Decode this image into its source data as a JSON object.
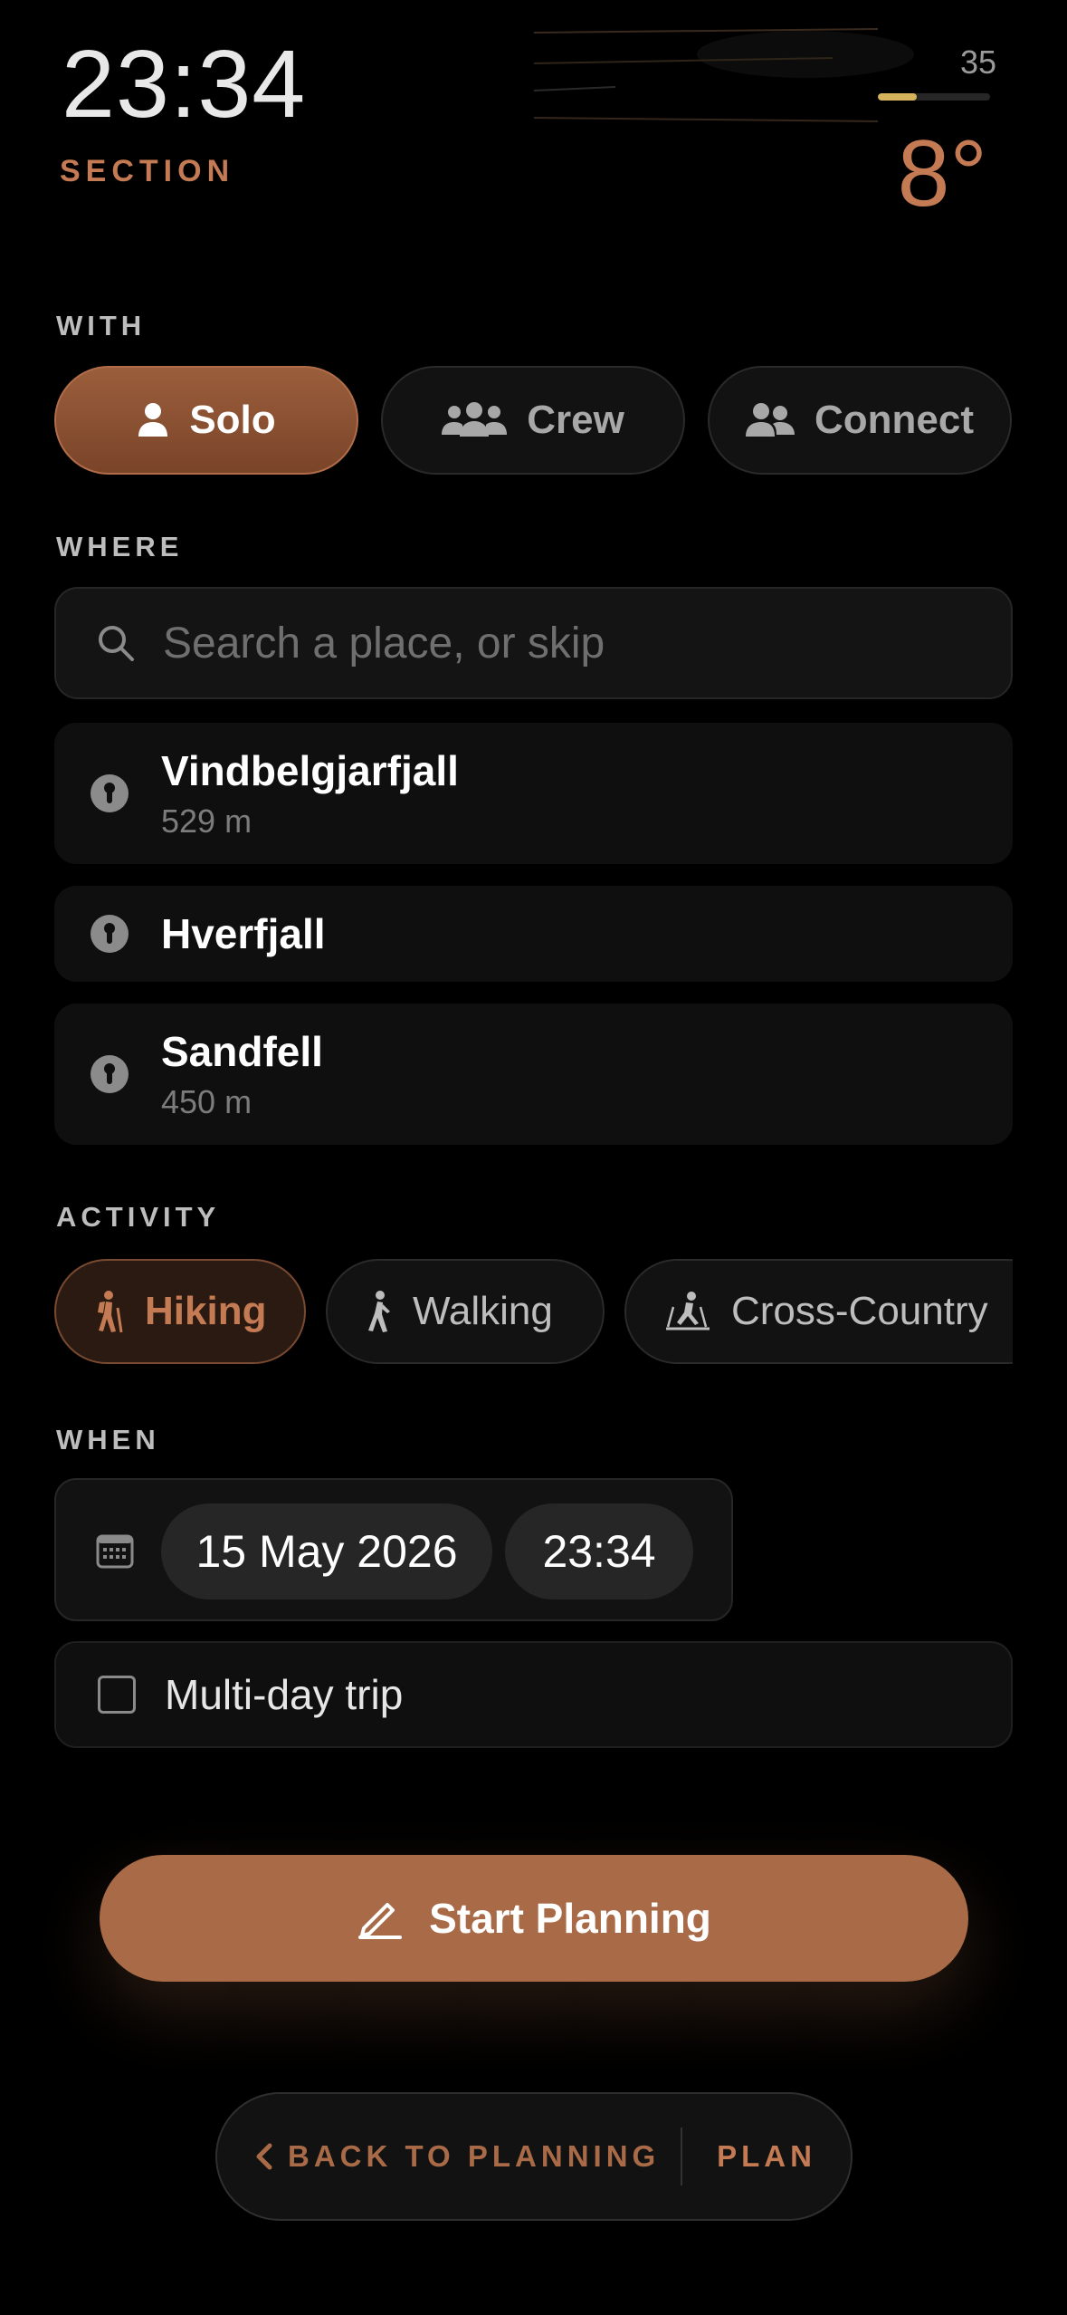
{
  "header": {
    "time": "23:34",
    "section_label": "SECTION",
    "uv_value": "35",
    "uv_fraction": 0.35,
    "temperature": "8°"
  },
  "with": {
    "title": "WITH",
    "options": [
      {
        "label": "Solo",
        "icon": "person-icon",
        "active": true
      },
      {
        "label": "Crew",
        "icon": "group-icon",
        "active": false
      },
      {
        "label": "Connect",
        "icon": "people-icon",
        "active": false
      }
    ]
  },
  "where": {
    "title": "WHERE",
    "search_placeholder": "Search a place, or skip",
    "places": [
      {
        "name": "Vindbelgjarfjall",
        "elevation": "529 m"
      },
      {
        "name": "Hverfjall",
        "elevation": ""
      },
      {
        "name": "Sandfell",
        "elevation": "450 m"
      }
    ]
  },
  "activity": {
    "title": "ACTIVITY",
    "options": [
      {
        "label": "Hiking",
        "icon": "hiking-icon",
        "active": true
      },
      {
        "label": "Walking",
        "icon": "walking-icon",
        "active": false
      },
      {
        "label": "Cross-Country",
        "icon": "skiing-icon",
        "active": false
      }
    ]
  },
  "when": {
    "title": "WHEN",
    "date": "15 May 2026",
    "time": "23:34",
    "multi_day_label": "Multi-day trip"
  },
  "actions": {
    "start_label": "Start Planning",
    "back_label": "BACK TO PLANNING",
    "plan_label": "PLAN"
  },
  "colors": {
    "accent": "#a86a47",
    "accent_text": "#c47a52",
    "uv_bar": "#d6b25a",
    "background": "#000000"
  }
}
